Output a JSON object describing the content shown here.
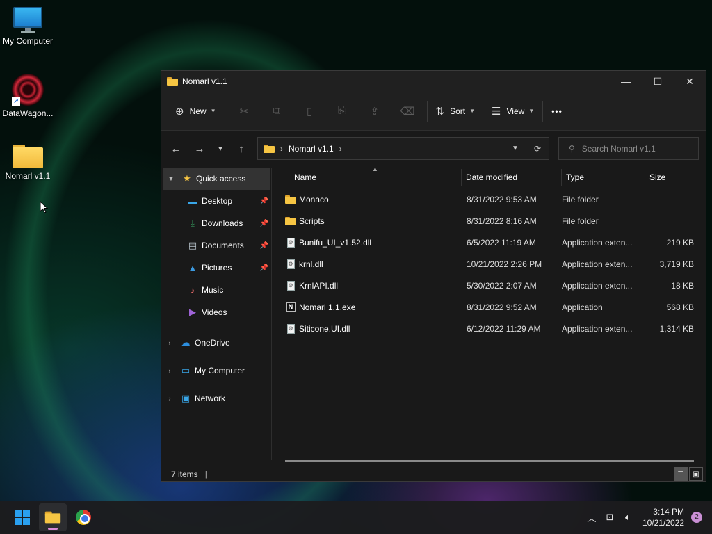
{
  "desktop": {
    "icons": [
      {
        "label": "My Computer",
        "icon": "monitor-icon"
      },
      {
        "label": "DataWagon...",
        "icon": "app-icon"
      },
      {
        "label": "Nomarl v1.1",
        "icon": "folder-icon"
      }
    ]
  },
  "window": {
    "title": "Nomarl v1.1",
    "controls": {
      "minimize": "—",
      "maximize": "☐",
      "close": "✕"
    }
  },
  "toolbar": {
    "new_label": "New",
    "sort_label": "Sort",
    "view_label": "View",
    "more_label": "•••",
    "icons": {
      "new": "⊕",
      "cut": "✂",
      "copy": "⧉",
      "paste": "📋",
      "rename": "⎘",
      "share": "⇪",
      "delete": "🗑",
      "sort": "⇅",
      "view": "☰"
    }
  },
  "address": {
    "path_segment": "Nomarl v1.1",
    "search_placeholder": "Search Nomarl v1.1"
  },
  "sidebar": {
    "quick_access": "Quick access",
    "pinned": [
      {
        "label": "Desktop",
        "pinned": true
      },
      {
        "label": "Downloads",
        "pinned": true
      },
      {
        "label": "Documents",
        "pinned": true
      },
      {
        "label": "Pictures",
        "pinned": true
      },
      {
        "label": "Music",
        "pinned": false
      },
      {
        "label": "Videos",
        "pinned": false
      }
    ],
    "roots": [
      {
        "label": "OneDrive"
      },
      {
        "label": "My Computer"
      },
      {
        "label": "Network"
      }
    ]
  },
  "columns": {
    "name": "Name",
    "date": "Date modified",
    "type": "Type",
    "size": "Size"
  },
  "files": [
    {
      "name": "Monaco",
      "date": "8/31/2022 9:53 AM",
      "type": "File folder",
      "size": "",
      "kind": "folder"
    },
    {
      "name": "Scripts",
      "date": "8/31/2022 8:16 AM",
      "type": "File folder",
      "size": "",
      "kind": "folder"
    },
    {
      "name": "Bunifu_UI_v1.52.dll",
      "date": "6/5/2022 11:19 AM",
      "type": "Application exten...",
      "size": "219 KB",
      "kind": "dll"
    },
    {
      "name": "krnl.dll",
      "date": "10/21/2022 2:26 PM",
      "type": "Application exten...",
      "size": "3,719 KB",
      "kind": "dll"
    },
    {
      "name": "KrnlAPI.dll",
      "date": "5/30/2022 2:07 AM",
      "type": "Application exten...",
      "size": "18 KB",
      "kind": "dll"
    },
    {
      "name": "Nomarl 1.1.exe",
      "date": "8/31/2022 9:52 AM",
      "type": "Application",
      "size": "568 KB",
      "kind": "exe"
    },
    {
      "name": "Siticone.UI.dll",
      "date": "6/12/2022 11:29 AM",
      "type": "Application exten...",
      "size": "1,314 KB",
      "kind": "dll"
    }
  ],
  "status": {
    "items_count": "7 items"
  },
  "taskbar": {
    "time": "3:14 PM",
    "date": "10/21/2022",
    "notifications": "2"
  }
}
